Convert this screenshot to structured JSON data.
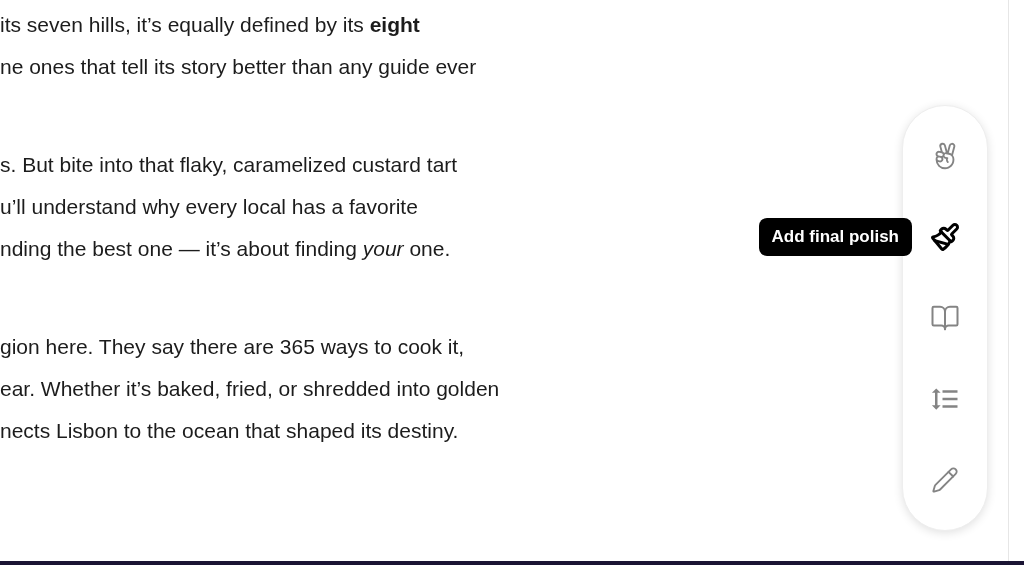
{
  "paragraphs": [
    {
      "lines": [
        "its seven hills, it’s equally defined by its **eight**",
        "ne ones that tell its story better than any guide ever"
      ]
    },
    {
      "lines": [
        "s. But bite into that flaky, caramelized custard tart",
        "u’ll understand why every local has a favorite",
        "nding the best one — it’s about finding *your* one."
      ]
    },
    {
      "lines": [
        "gion here. They say there are 365 ways to cook it,",
        "ear. Whether it’s baked, fried, or shredded into golden",
        "nects Lisbon to the ocean that shaped its destiny."
      ]
    }
  ],
  "toolbar": {
    "tools": [
      {
        "kind": "peace",
        "selected": false
      },
      {
        "kind": "brush",
        "selected": true,
        "tooltip": "Add final polish"
      },
      {
        "kind": "book",
        "selected": false
      },
      {
        "kind": "spacing",
        "selected": false
      },
      {
        "kind": "pencil",
        "selected": false
      }
    ]
  }
}
